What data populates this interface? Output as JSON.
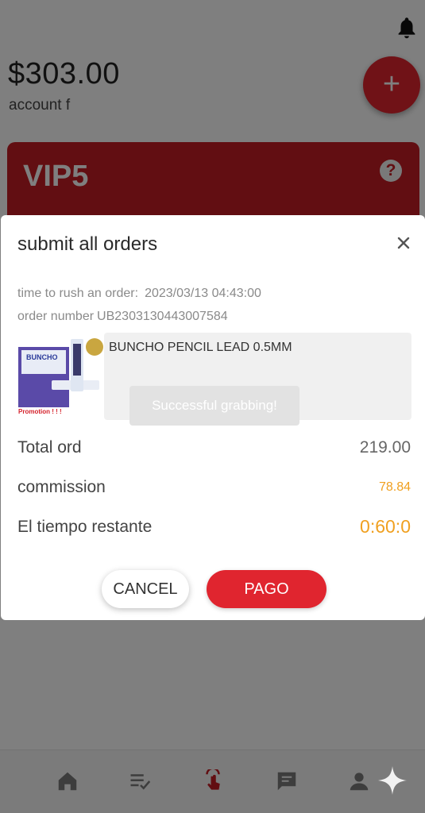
{
  "header": {
    "notification_icon": "bell-icon",
    "balance": "$303.00",
    "account_label": "account f"
  },
  "fab": {
    "label": "+"
  },
  "vip": {
    "level": "VIP5",
    "help_label": "?"
  },
  "dialog": {
    "title": "submit all orders",
    "close_icon": "close-icon",
    "rush_time_label": "time to rush an order:",
    "rush_time_value": "2023/03/13 04:43:00",
    "order_number_label": "order number",
    "order_number_value": "UB2303130443007584",
    "product": {
      "name": "BUNCHO PENCIL LEAD 0.5MM",
      "image_brand_text": "BUNCHO",
      "image_promo_text": "Promotion ! ! !"
    },
    "toast": "Successful grabbing!",
    "rows": {
      "total_label": "Total ord",
      "total_value": "219.00",
      "commission_label": "commission",
      "commission_value": "78.84",
      "remaining_label": "El tiempo restante",
      "remaining_value": "0:60:0"
    },
    "buttons": {
      "cancel": "CANCEL",
      "pay": "PAGO"
    }
  },
  "bottom_nav": {
    "items": [
      {
        "icon": "home-icon"
      },
      {
        "icon": "order-list-icon"
      },
      {
        "icon": "grab-hand-icon"
      },
      {
        "icon": "chat-icon"
      },
      {
        "icon": "profile-icon"
      }
    ]
  },
  "colors": {
    "brand_red": "#e0252f",
    "vip_red": "#c51c24",
    "commission_orange": "#f0a020",
    "timer_gold": "#f0a020"
  }
}
